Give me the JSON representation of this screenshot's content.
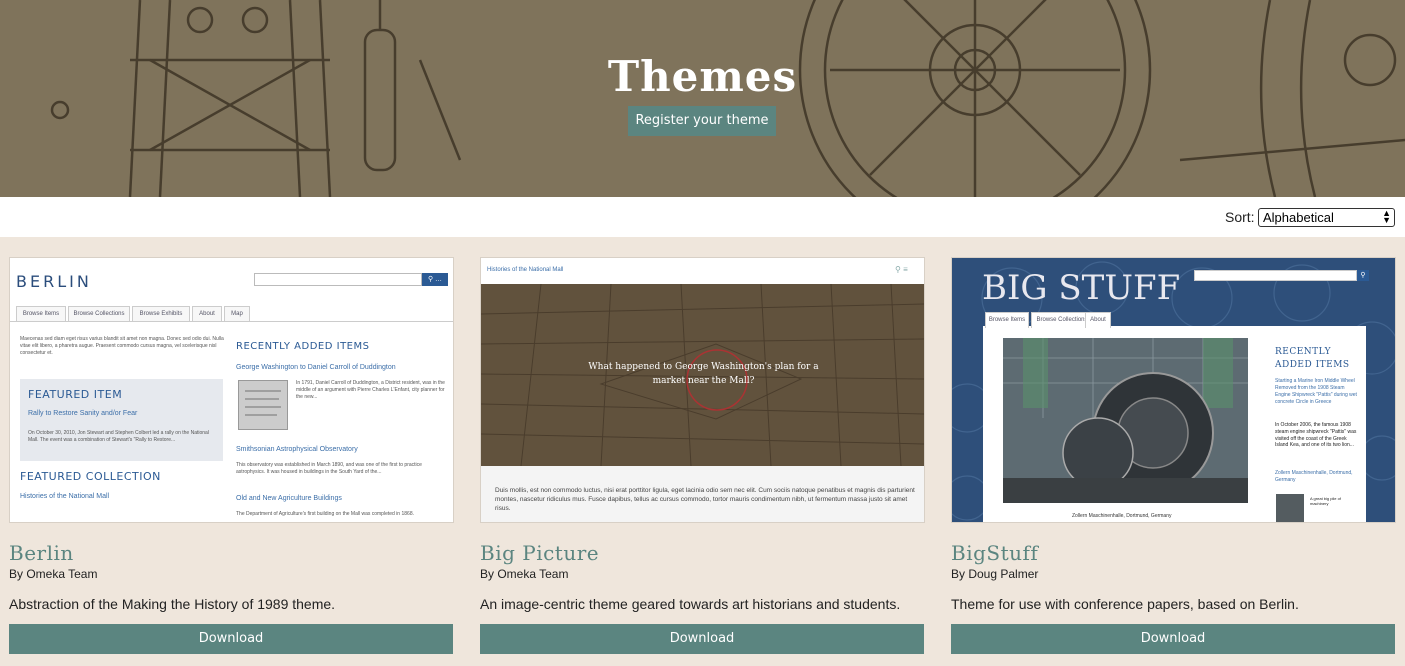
{
  "hero": {
    "title": "Themes",
    "register_label": "Register your theme"
  },
  "sort": {
    "label": "Sort:",
    "selected": "Alphabetical"
  },
  "colors": {
    "accent": "#5b8580",
    "page_bg": "#efe6dc",
    "hero_bg": "#8a7e66"
  },
  "themes": [
    {
      "name": "Berlin",
      "author": "By Omeka Team",
      "description": "Abstraction of the Making the History of 1989 theme.",
      "download_label": "Download",
      "preview": {
        "logo": "BERLIN",
        "tabs": [
          "Browse Items",
          "Browse Collections",
          "Browse Exhibits",
          "About",
          "Map"
        ],
        "intro": "Maecenas sed diam eget risus varius blandit sit amet non magna. Donec sed odio dui. Nulla vitae elit libero, a pharetra augue. Praesent commodo cursus magna, vel scelerisque nisl consectetur et.",
        "featured_item_heading": "FEATURED ITEM",
        "featured_item_title": "Rally to Restore Sanity and/or Fear",
        "featured_item_text": "On October 30, 2010, Jon Stewart and Stephen Colbert led a rally on the National Mall. The event was a combination of Stewart's \"Rally to Restore...",
        "featured_collection_heading": "FEATURED COLLECTION",
        "featured_collection_title": "Histories of the National Mall",
        "recent_heading": "RECENTLY ADDED ITEMS",
        "recent_1_title": "George Washington to Daniel Carroll of Duddington",
        "recent_1_text": "In 1791, Daniel Carroll of Duddington, a District resident, was in the middle of an argument with Pierre Charles L'Enfant, city planner for the new...",
        "recent_2_title": "Smithsonian Astrophysical Observatory",
        "recent_2_text": "This observatory was established in March 1890, and was one of the first to practice astrophysics. It was housed in buildings in the South Yard of the...",
        "recent_3_title": "Old and New Agriculture Buildings",
        "recent_3_text": "The Department of Agriculture's first building on the Mall was completed in 1868."
      }
    },
    {
      "name": "Big Picture",
      "author": "By Omeka Team",
      "description": "An image-centric theme geared towards art historians and students.",
      "download_label": "Download",
      "preview": {
        "site_title": "Histories of the National Mall",
        "overlay_text": "What happened to George Washington's plan for a market near the Mall?",
        "body_text": "Duis mollis, est non commodo luctus, nisi erat porttitor ligula, eget lacinia odio sem nec elit. Cum sociis natoque penatibus et magnis dis parturient montes, nascetur ridiculus mus. Fusce dapibus, tellus ac cursus commodo, tortor mauris condimentum nibh, ut fermentum massa justo sit amet risus."
      }
    },
    {
      "name": "BigStuff",
      "author": "By Doug Palmer",
      "description": "Theme for use with conference papers, based on Berlin.",
      "download_label": "Download",
      "preview": {
        "logo": "BIG STUFF",
        "tabs": [
          "Browse Items",
          "Browse Collections",
          "About"
        ],
        "recent_heading": "RECENTLY ADDED ITEMS",
        "recent_1_title": "Starting a Marine Iron Middle Wheel Removed from the 1908 Steam Engine Shipwreck \"Pattis\" during wet concrete Circle in Greece",
        "recent_1_text": "In October 2006, the famous 1908 steam engine shipwreck \"Pattis\" was visited off the coast of the Greek Island Kea, and one of its two lion...",
        "recent_2_title": "Zollern Maschinenhalle, Dortmund, Germany",
        "recent_2_text": "A great big pile of machinery",
        "caption": "Zollern Maschinenhalle, Dortmund, Germany"
      }
    }
  ]
}
